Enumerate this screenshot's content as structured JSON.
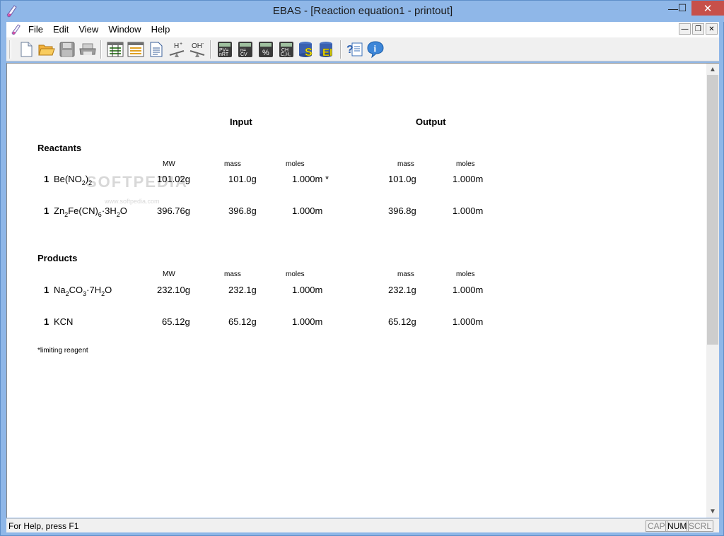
{
  "window": {
    "title": "EBAS - [Reaction equation1 - printout]",
    "min_glyph": "—",
    "max_glyph": "☐",
    "close_glyph": "✕"
  },
  "menu": {
    "items": [
      "File",
      "Edit",
      "View",
      "Window",
      "Help"
    ],
    "mdi_min": "—",
    "mdi_restore": "❐",
    "mdi_close": "✕"
  },
  "toolbar": {
    "buttons": [
      "new-icon",
      "open-icon",
      "save-icon",
      "print-icon",
      "table-icon",
      "list-icon",
      "document-icon",
      "h-plus-balance-icon",
      "oh-minus-balance-icon",
      "pv-nrt-icon",
      "m-cv-icon",
      "percent-icon",
      "chn-icon",
      "s-database-icon",
      "ei-database-icon",
      "help-context-icon",
      "info-icon"
    ],
    "h_plus": "H",
    "oh_minus": "OH",
    "pv_top": "PV=",
    "pv_bottom": "nRT",
    "mcv_top": "n=",
    "mcv_bottom": "CV",
    "pct": "%",
    "chn_top": "CH",
    "chn_bottom": "C,H,",
    "s_label": "S",
    "e_label": "EI"
  },
  "printout": {
    "col_input": "Input",
    "col_output": "Output",
    "watermark": "SOFTPEDIA",
    "watermark_url": "www.softpedia.com",
    "reactants_title": "Reactants",
    "products_title": "Products",
    "sub_headers": {
      "mw": "MW",
      "mass": "mass",
      "moles": "moles",
      "out_mass": "mass",
      "out_moles": "moles"
    },
    "reactants": [
      {
        "coef": "1",
        "mw": "101.02g",
        "mass": "101.0g",
        "moles": "1.000m *",
        "out_mass": "101.0g",
        "out_moles": "1.000m"
      },
      {
        "coef": "1",
        "mw": "396.76g",
        "mass": "396.8g",
        "moles": "1.000m",
        "out_mass": "396.8g",
        "out_moles": "1.000m"
      }
    ],
    "products": [
      {
        "coef": "1",
        "mw": "232.10g",
        "mass": "232.1g",
        "moles": "1.000m",
        "out_mass": "232.1g",
        "out_moles": "1.000m"
      },
      {
        "coef": "1",
        "formula": "KCN",
        "mw": "65.12g",
        "mass": "65.12g",
        "moles": "1.000m",
        "out_mass": "65.12g",
        "out_moles": "1.000m"
      }
    ],
    "footnote": "*limiting reagent"
  },
  "status": {
    "help_text": "For Help, press F1",
    "cap": "CAP",
    "num": "NUM",
    "scrl": "SCRL"
  }
}
